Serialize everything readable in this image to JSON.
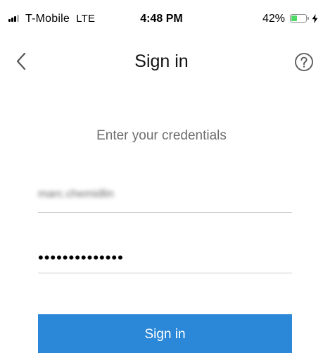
{
  "status_bar": {
    "carrier": "T-Mobile",
    "network": "LTE",
    "time": "4:48 PM",
    "battery_percent": "42%",
    "battery_level": 0.42,
    "battery_color": "#4cd964",
    "charging": true,
    "signal_bars_active": 3,
    "signal_bars_total": 4
  },
  "nav": {
    "back_icon": "chevron-left-icon",
    "title": "Sign in",
    "help_icon": "question-circle-icon"
  },
  "form": {
    "prompt": "Enter your credentials",
    "username_value": "marc.chemidlin",
    "password_value": "••••••••••••••"
  },
  "actions": {
    "sign_in_label": "Sign in",
    "sign_in_color": "#2b88d8"
  }
}
